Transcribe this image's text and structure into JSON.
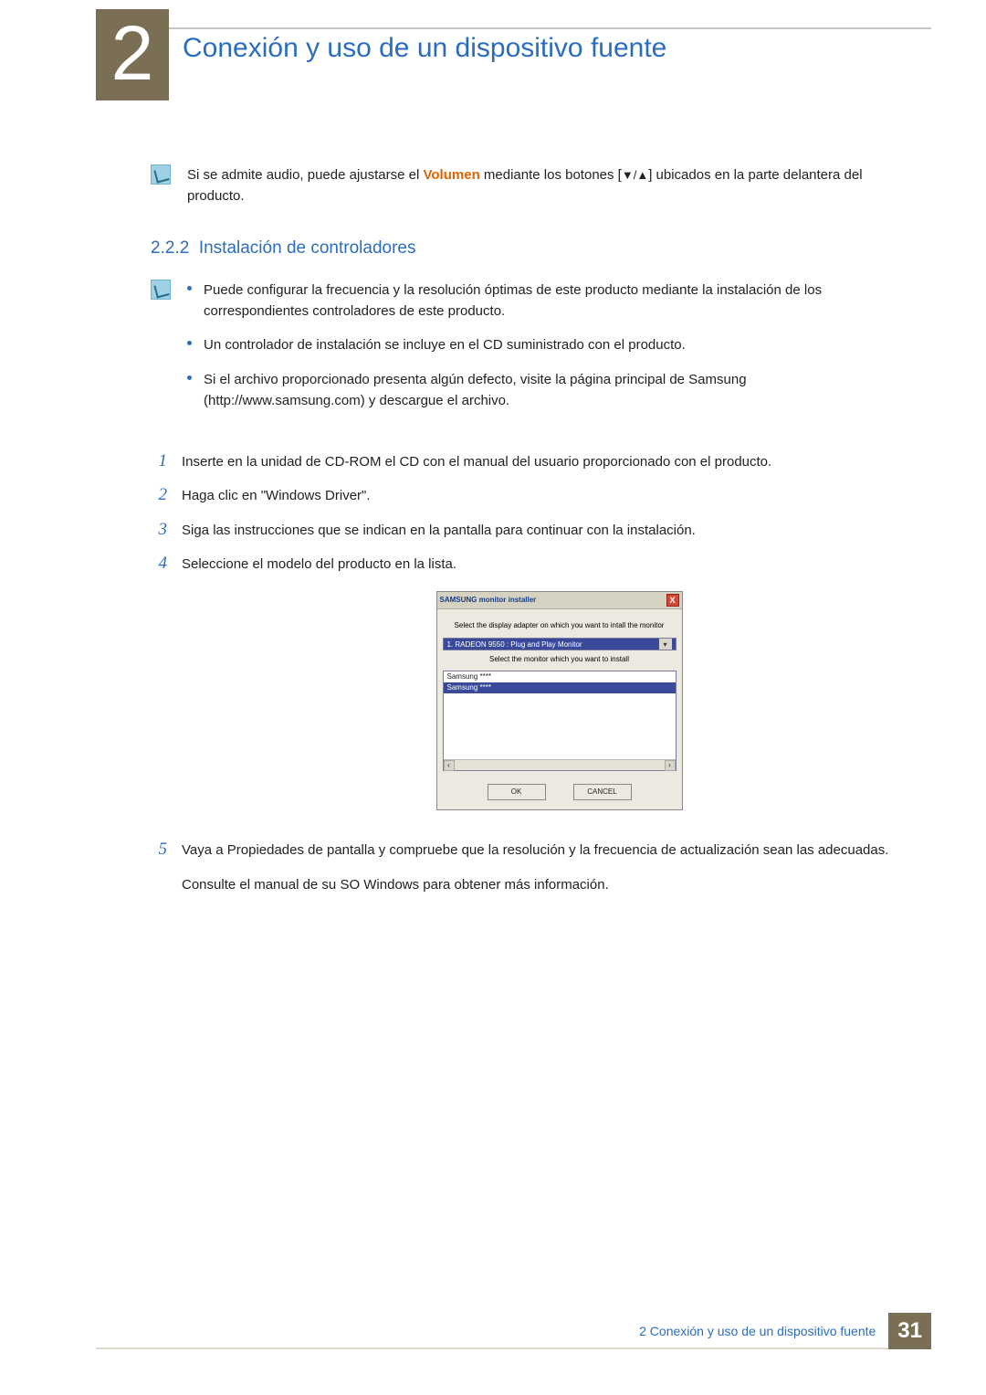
{
  "chapter": {
    "number": "2",
    "title": "Conexión y uso de un dispositivo fuente"
  },
  "note1": {
    "pre": "Si se admite audio, puede ajustarse el ",
    "highlight": "Volumen",
    "mid": " mediante los botones [",
    "tri": "▼/▲",
    "post": "] ubicados en la parte delantera del producto."
  },
  "section": {
    "num": "2.2.2",
    "title": "Instalación de controladores"
  },
  "bullets": [
    "Puede configurar la frecuencia y la resolución óptimas de este producto mediante la instalación de los correspondientes controladores de este producto.",
    "Un controlador de instalación se incluye en el CD suministrado con el producto.",
    "Si el archivo proporcionado presenta algún defecto, visite la página principal de Samsung (http://www.samsung.com) y descargue el archivo."
  ],
  "steps": [
    {
      "n": "1",
      "text": "Inserte en la unidad de CD-ROM el CD con el manual del usuario proporcionado con el producto."
    },
    {
      "n": "2",
      "text": "Haga clic en \"Windows Driver\"."
    },
    {
      "n": "3",
      "text": "Siga las instrucciones que se indican en la pantalla para continuar con la instalación."
    },
    {
      "n": "4",
      "text": "Seleccione el modelo del producto en la lista."
    },
    {
      "n": "5",
      "text": "Vaya a Propiedades de pantalla y compruebe que la resolución y la frecuencia de actualización sean las adecuadas.",
      "extra": "Consulte el manual de su SO Windows para obtener más información."
    }
  ],
  "installer": {
    "title": "SAMSUNG monitor installer",
    "label1": "Select the display adapter on which you want to intall the monitor",
    "adapter": "1. RADEON 9550 : Plug and Play Monitor",
    "label2": "Select the monitor which you want to install",
    "items": [
      "Samsung ****",
      "Samsung ****"
    ],
    "ok": "OK",
    "cancel": "CANCEL",
    "close": "X"
  },
  "footer": {
    "text": "2 Conexión y uso de un dispositivo fuente",
    "page": "31"
  }
}
